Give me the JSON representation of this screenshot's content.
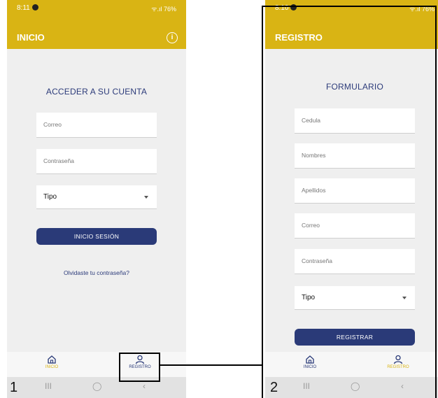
{
  "screen1": {
    "status": {
      "time": "8:11",
      "signal": "ᯤ.ıl 76%"
    },
    "appbar": {
      "title": "INICIO",
      "info_icon": "i"
    },
    "heading": "ACCEDER A SU CUENTA",
    "fields": {
      "email_placeholder": "Correo",
      "password_placeholder": "Contraseña"
    },
    "type_select": {
      "value": "Tipo"
    },
    "login_button": "INICIO SESIÓN",
    "forgot_link": "Olvidaste tu contraseña?",
    "nav": {
      "home": "INICIO",
      "register": "REGISTRO"
    },
    "sysnav": {
      "recent": "III",
      "home": "◯",
      "back": "‹"
    },
    "number": "1"
  },
  "screen2": {
    "status": {
      "time": "8:10",
      "signal": "ᯤ.ıl 76%"
    },
    "appbar": {
      "title": "REGISTRO"
    },
    "heading": "FORMULARIO",
    "fields": {
      "cedula": "Cedula",
      "nombres": "Nombres",
      "apellidos": "Apellidos",
      "correo": "Correo",
      "contrasena": "Contraseña"
    },
    "type_select": {
      "value": "Tipo"
    },
    "register_button": "REGISTRAR",
    "nav": {
      "home": "INICIO",
      "register": "REGISTRO"
    },
    "sysnav": {
      "recent": "III",
      "home": "◯",
      "back": "‹"
    },
    "number": "2"
  },
  "colors": {
    "appbar": "#d9b414",
    "primary": "#2a3a78",
    "nav_active": "#d9b414",
    "nav_inactive": "#2a3a78"
  },
  "icons": {
    "info": "info-icon",
    "home": "home-icon",
    "user": "user-icon"
  }
}
